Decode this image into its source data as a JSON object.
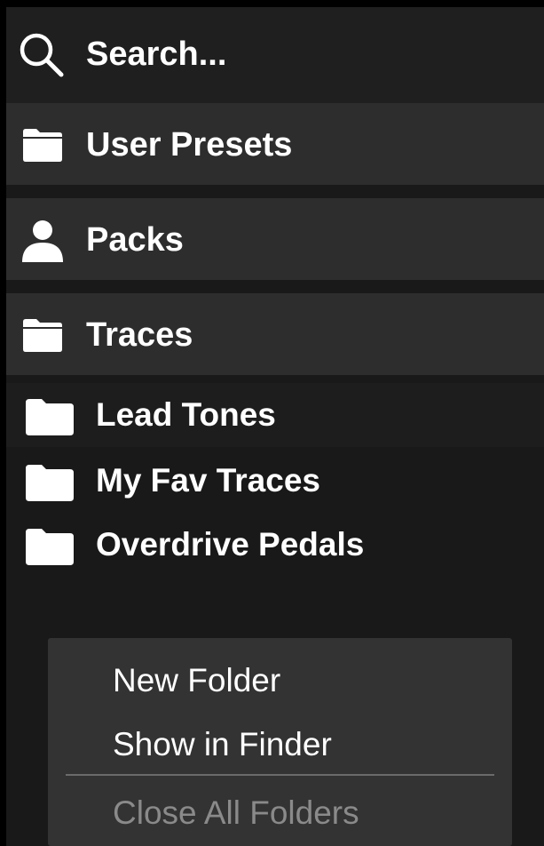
{
  "search": {
    "label": "Search...",
    "icon": "search-icon"
  },
  "sections": [
    {
      "label": "User Presets",
      "icon": "folder-icon"
    },
    {
      "label": "Packs",
      "icon": "person-icon"
    },
    {
      "label": "Traces",
      "icon": "folder-icon"
    }
  ],
  "traces_folders": [
    {
      "label": "Lead Tones",
      "icon": "folder-icon"
    },
    {
      "label": "My Fav Traces",
      "icon": "folder-icon"
    },
    {
      "label": "Overdrive Pedals",
      "icon": "folder-icon"
    }
  ],
  "context_menu": {
    "items": [
      {
        "label": "New Folder",
        "enabled": true
      },
      {
        "label": "Show in Finder",
        "enabled": true
      },
      {
        "label": "Close All Folders",
        "enabled": false
      }
    ]
  },
  "colors": {
    "background": "#000000",
    "panel": "#191919",
    "section_header": "#2d2d2d",
    "menu": "#333333",
    "text": "#ffffff",
    "disabled_text": "#8a8a8a"
  }
}
